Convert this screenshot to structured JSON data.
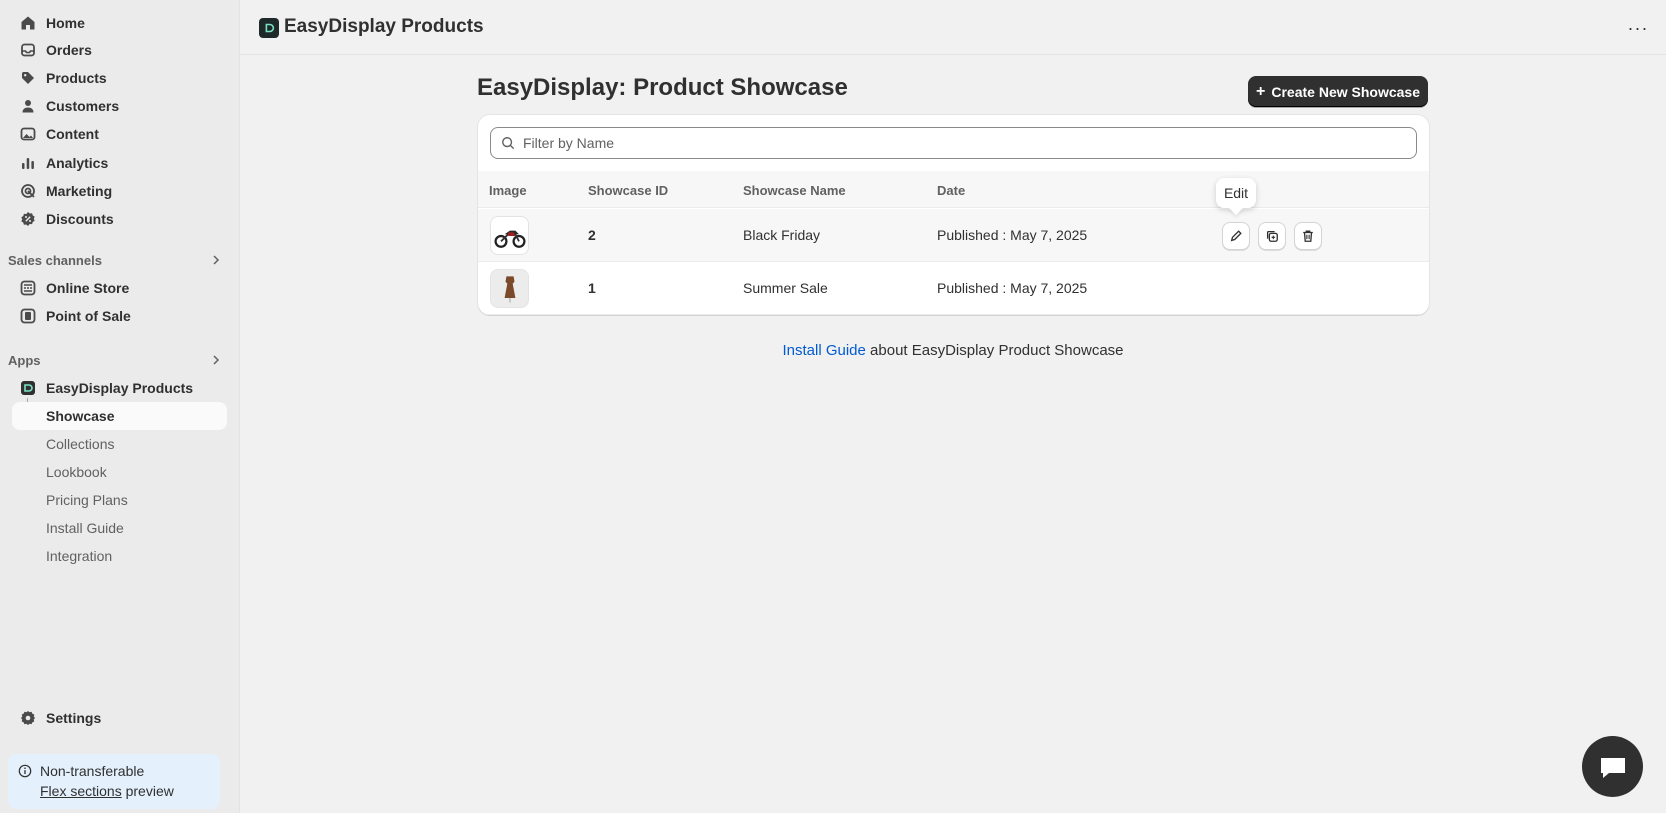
{
  "sidebar": {
    "main_items": [
      {
        "label": "Home",
        "icon": "home-icon"
      },
      {
        "label": "Orders",
        "icon": "inbox-icon"
      },
      {
        "label": "Products",
        "icon": "tag-icon"
      },
      {
        "label": "Customers",
        "icon": "person-icon"
      },
      {
        "label": "Content",
        "icon": "image-icon"
      },
      {
        "label": "Analytics",
        "icon": "bar-chart-icon"
      },
      {
        "label": "Marketing",
        "icon": "target-icon"
      },
      {
        "label": "Discounts",
        "icon": "discount-icon"
      }
    ],
    "sales_channels_label": "Sales channels",
    "sales_channels": [
      {
        "label": "Online Store",
        "icon": "store-icon"
      },
      {
        "label": "Point of Sale",
        "icon": "pos-icon"
      }
    ],
    "apps_label": "Apps",
    "app_name": "EasyDisplay Products",
    "app_sub_items": [
      "Showcase",
      "Collections",
      "Lookbook",
      "Pricing Plans",
      "Install Guide",
      "Integration"
    ],
    "settings_label": "Settings",
    "notice_line1": "Non-transferable",
    "notice_link": "Flex sections",
    "notice_suffix": " preview"
  },
  "header": {
    "app_title": "EasyDisplay Products",
    "more_label": "···"
  },
  "main": {
    "page_title": "EasyDisplay: Product Showcase",
    "create_button": "Create New Showcase",
    "search_placeholder": "Filter by Name",
    "columns": [
      "Image",
      "Showcase ID",
      "Showcase Name",
      "Date"
    ],
    "rows": [
      {
        "id": "2",
        "name": "Black Friday",
        "date": "Published : May 7, 2025",
        "image": "motorcycle"
      },
      {
        "id": "1",
        "name": "Summer Sale",
        "date": "Published : May 7, 2025",
        "image": "dress"
      }
    ],
    "tooltip": "Edit",
    "footer_link": "Install Guide",
    "footer_text": " about EasyDisplay Product Showcase"
  },
  "colors": {
    "accent_link": "#005bd3",
    "primary_button": "#303030",
    "sidebar_bg": "#ebebeb",
    "page_bg": "#f1f1f1"
  }
}
